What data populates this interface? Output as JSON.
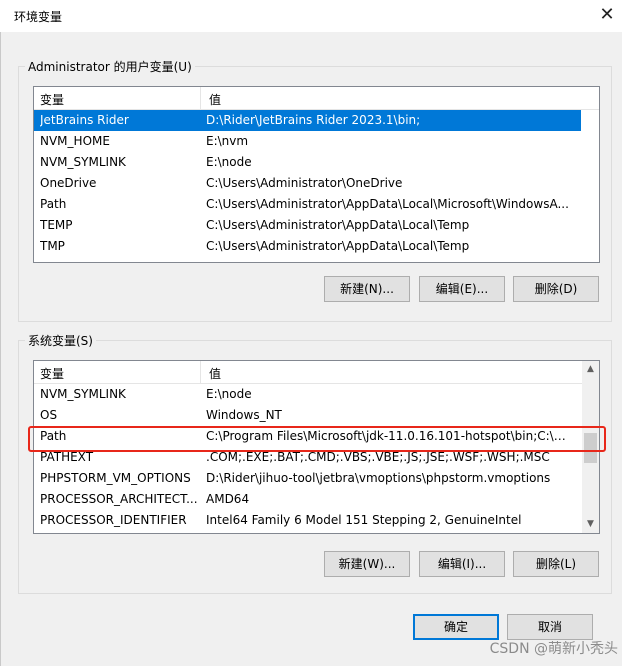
{
  "window": {
    "title": "环境变量",
    "close_glyph": "✕"
  },
  "user_section": {
    "legend": "Administrator 的用户变量(U)",
    "col_variable": "变量",
    "col_value": "值",
    "rows": [
      {
        "name": "JetBrains Rider",
        "value": "D:\\Rider\\JetBrains Rider 2023.1\\bin;"
      },
      {
        "name": "NVM_HOME",
        "value": "E:\\nvm"
      },
      {
        "name": "NVM_SYMLINK",
        "value": "E:\\node"
      },
      {
        "name": "OneDrive",
        "value": "C:\\Users\\Administrator\\OneDrive"
      },
      {
        "name": "Path",
        "value": "C:\\Users\\Administrator\\AppData\\Local\\Microsoft\\WindowsA..."
      },
      {
        "name": "TEMP",
        "value": "C:\\Users\\Administrator\\AppData\\Local\\Temp"
      },
      {
        "name": "TMP",
        "value": "C:\\Users\\Administrator\\AppData\\Local\\Temp"
      }
    ],
    "buttons": {
      "new": "新建(N)...",
      "edit": "编辑(E)...",
      "delete": "删除(D)"
    }
  },
  "system_section": {
    "legend": "系统变量(S)",
    "col_variable": "变量",
    "col_value": "值",
    "rows": [
      {
        "name": "NVM_SYMLINK",
        "value": "E:\\node"
      },
      {
        "name": "OS",
        "value": "Windows_NT"
      },
      {
        "name": "Path",
        "value": "C:\\Program Files\\Microsoft\\jdk-11.0.16.101-hotspot\\bin;C:\\Wi..."
      },
      {
        "name": "PATHEXT",
        "value": ".COM;.EXE;.BAT;.CMD;.VBS;.VBE;.JS;.JSE;.WSF;.WSH;.MSC"
      },
      {
        "name": "PHPSTORM_VM_OPTIONS",
        "value": "D:\\Rider\\jihuo-tool\\jetbra\\vmoptions\\phpstorm.vmoptions"
      },
      {
        "name": "PROCESSOR_ARCHITECT...",
        "value": "AMD64"
      },
      {
        "name": "PROCESSOR_IDENTIFIER",
        "value": "Intel64 Family 6 Model 151 Stepping 2, GenuineIntel"
      }
    ],
    "buttons": {
      "new": "新建(W)...",
      "edit": "编辑(I)...",
      "delete": "删除(L)"
    }
  },
  "footer": {
    "ok": "确定",
    "cancel": "取消"
  },
  "watermark": "CSDN @萌新小秃头",
  "colors": {
    "selection": "#0078d7",
    "highlight": "#e8271a"
  }
}
